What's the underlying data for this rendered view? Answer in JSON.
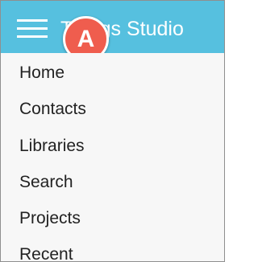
{
  "header": {
    "title": "Things Studio",
    "background_color": "#56c0df",
    "menu_icon": "hamburger-icon"
  },
  "callout": {
    "label": "A",
    "color": "#ef5d4e"
  },
  "nav": {
    "items": [
      {
        "label": "Home"
      },
      {
        "label": "Contacts"
      },
      {
        "label": "Libraries"
      },
      {
        "label": "Search"
      },
      {
        "label": "Projects"
      },
      {
        "label": "Recent"
      }
    ]
  }
}
